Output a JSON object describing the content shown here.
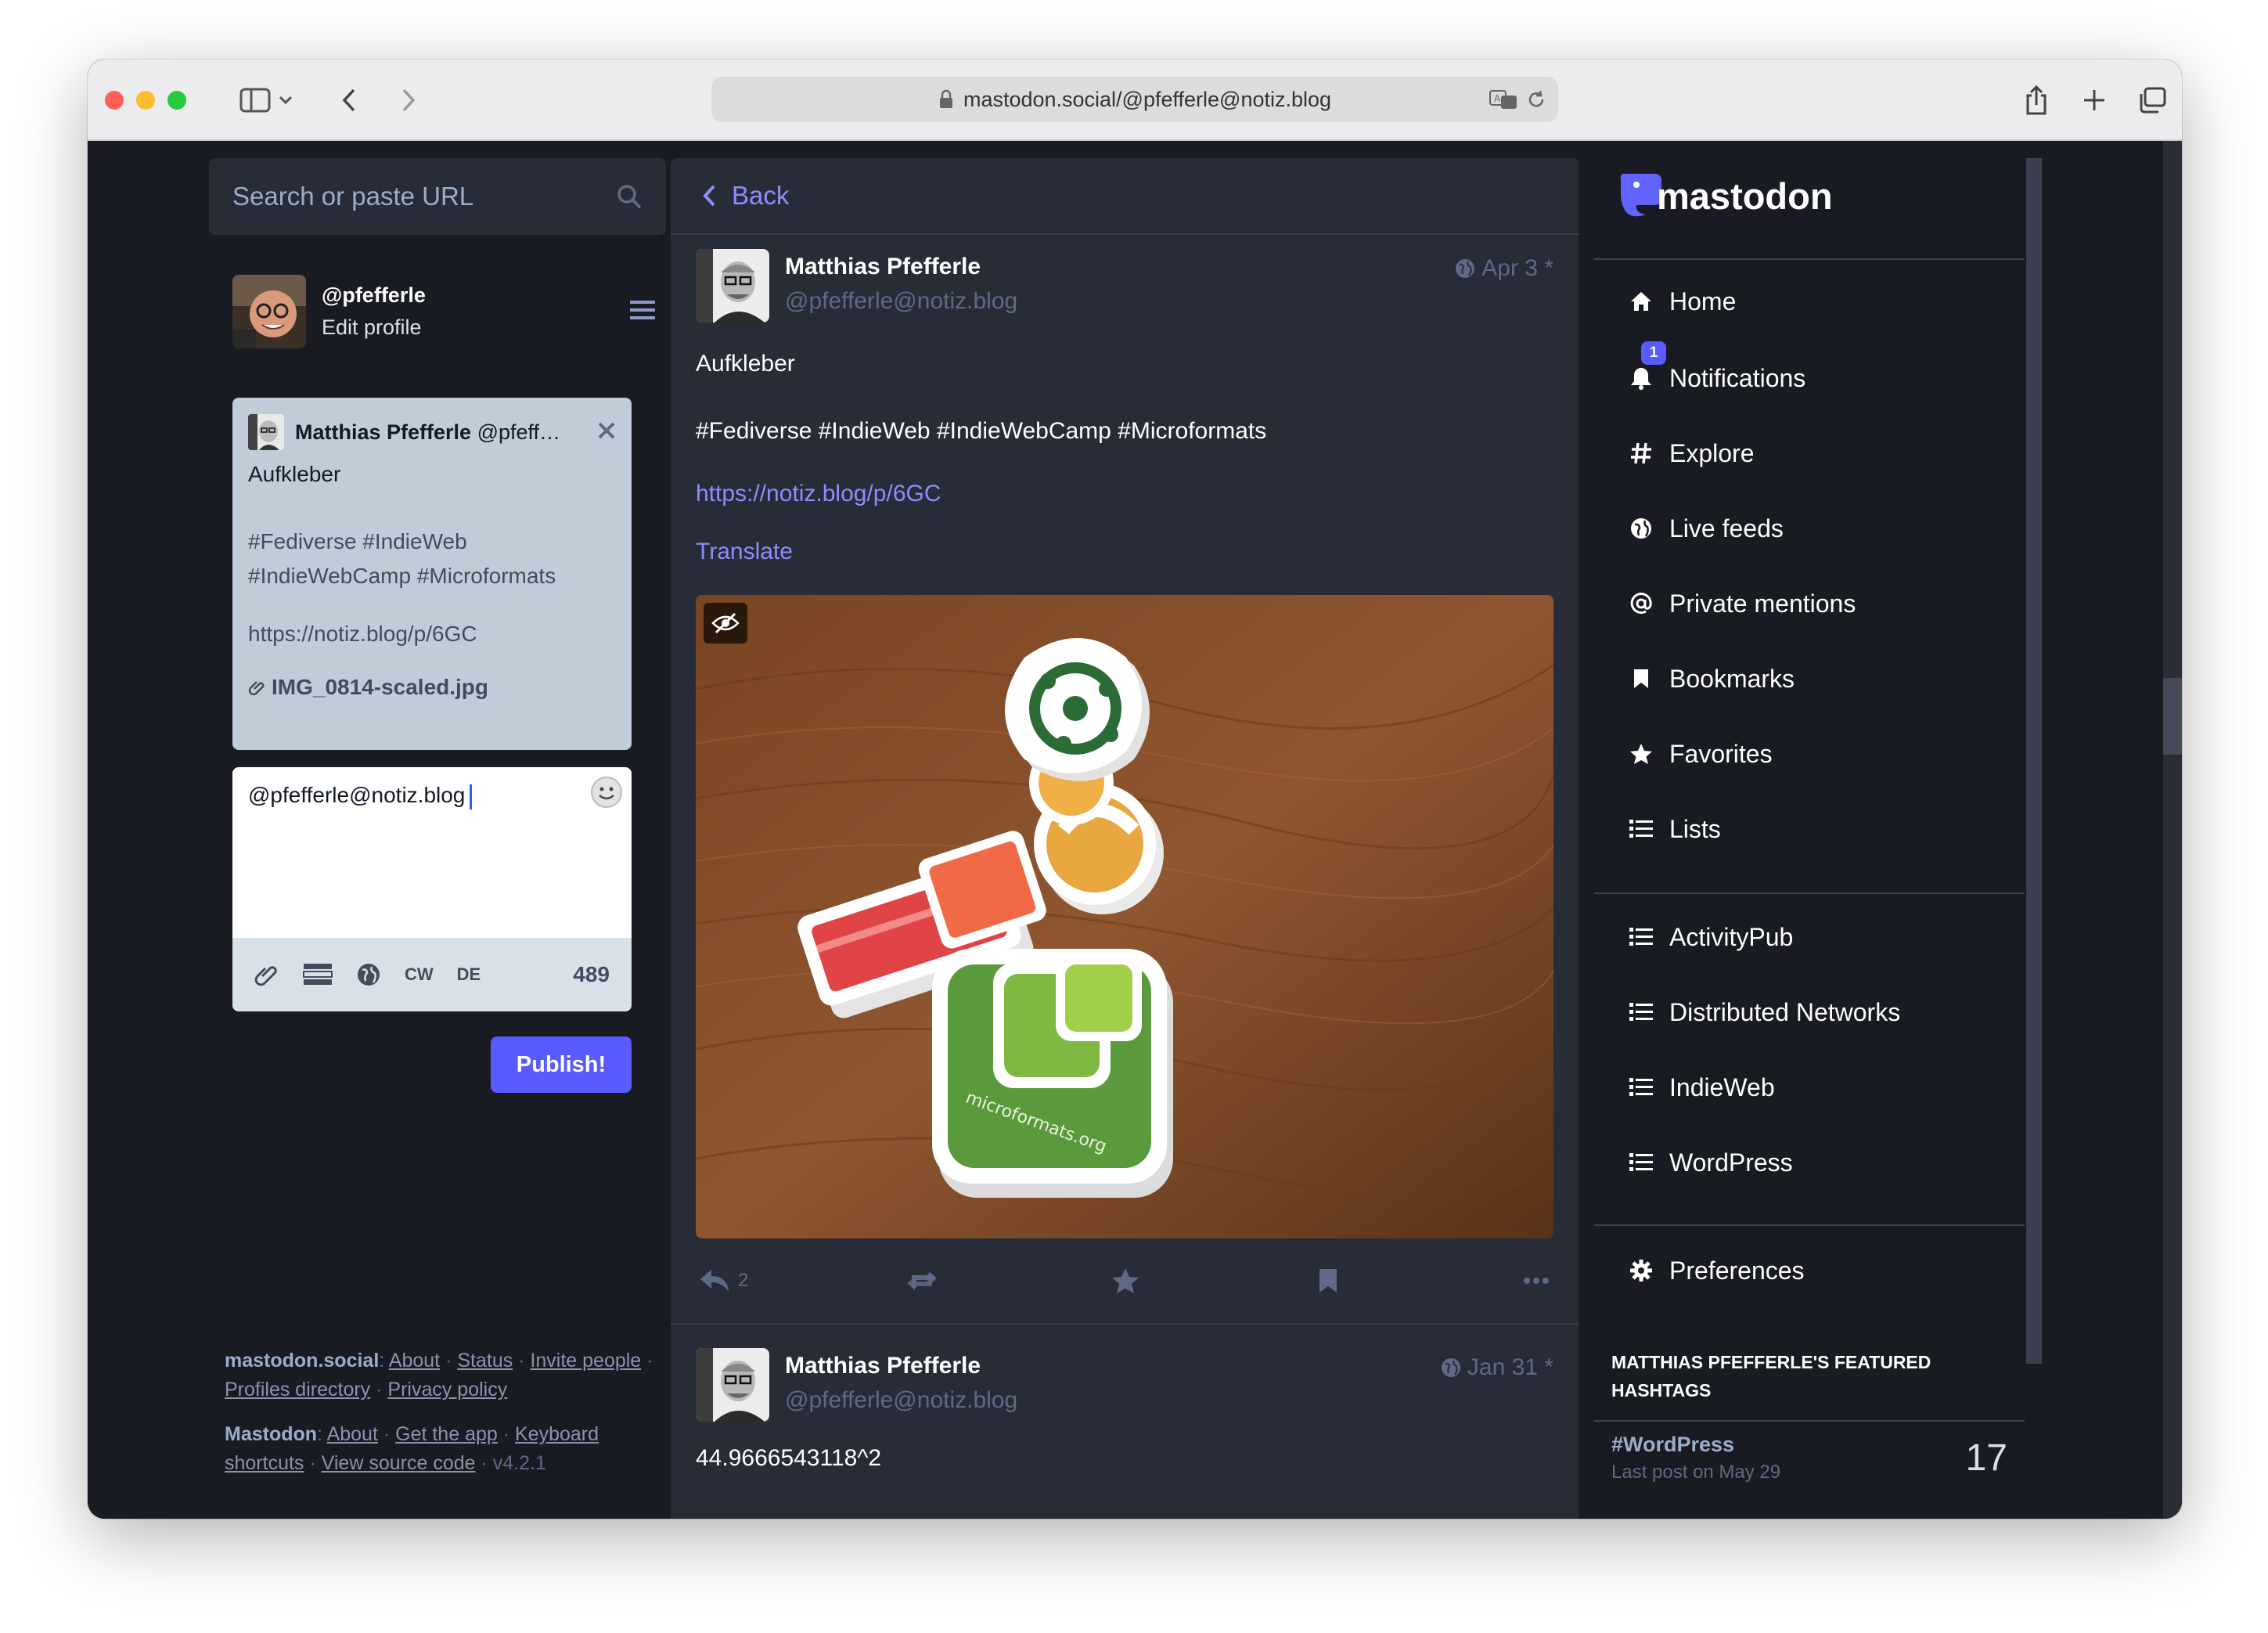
{
  "browser": {
    "url": "mastodon.social/@pfefferle@notiz.blog"
  },
  "left": {
    "search_placeholder": "Search or paste URL",
    "account": {
      "handle": "@pfefferle",
      "edit_label": "Edit profile"
    },
    "reply_card": {
      "name": "Matthias Pfefferle",
      "acct": "@pfeff…",
      "text": "Aufkleber",
      "tags": "#Fediverse #IndieWeb #IndieWebCamp #Microformats",
      "link": "https://notiz.blog/p/6GC",
      "attachment": "IMG_0814-scaled.jpg"
    },
    "compose": {
      "text": "@pfefferle@notiz.blog",
      "cw_label": "CW",
      "lang_label": "DE",
      "char_count": "489",
      "publish_label": "Publish!"
    },
    "footer": {
      "host": "mastodon.social",
      "links1": [
        "About",
        "Status",
        "Invite people",
        "Profiles directory",
        "Privacy policy"
      ],
      "brand": "Mastodon",
      "links2": [
        "About",
        "Get the app",
        "Keyboard shortcuts",
        "View source code"
      ],
      "version": "v4.2.1"
    }
  },
  "center": {
    "back_label": "Back",
    "status": {
      "display_name": "Matthias Pfefferle",
      "acct": "@pfefferle@notiz.blog",
      "time": "Apr 3",
      "edited_mark": "*",
      "text": "Aufkleber",
      "tags": "#Fediverse #IndieWeb #IndieWebCamp #Microformats",
      "link": "https://notiz.blog/p/6GC",
      "translate_label": "Translate",
      "sticker_caption": "microformats.org",
      "reply_count": "2"
    },
    "status2": {
      "display_name": "Matthias Pfefferle",
      "acct": "@pfefferle@notiz.blog",
      "time": "Jan 31",
      "edited_mark": "*",
      "text": "44.9666543118^2"
    }
  },
  "right": {
    "logo_text": "mastodon",
    "nav": [
      {
        "label": "Home",
        "icon": "home-icon"
      },
      {
        "label": "Notifications",
        "icon": "bell-icon",
        "badge": "1"
      },
      {
        "label": "Explore",
        "icon": "hashtag-icon"
      },
      {
        "label": "Live feeds",
        "icon": "globe-icon"
      },
      {
        "label": "Private mentions",
        "icon": "at-icon"
      },
      {
        "label": "Bookmarks",
        "icon": "bookmark-icon"
      },
      {
        "label": "Favorites",
        "icon": "star-icon"
      },
      {
        "label": "Lists",
        "icon": "list-icon"
      }
    ],
    "lists": [
      {
        "label": "ActivityPub",
        "icon": "list-icon"
      },
      {
        "label": "Distributed Networks",
        "icon": "list-icon"
      },
      {
        "label": "IndieWeb",
        "icon": "list-icon"
      },
      {
        "label": "WordPress",
        "icon": "list-icon"
      }
    ],
    "preferences_label": "Preferences",
    "featured": {
      "title": "MATTHIAS PFEFFERLE'S FEATURED HASHTAGS",
      "tag": "#WordPress",
      "sub": "Last post on May 29",
      "count": "17"
    }
  },
  "colors": {
    "accent": "#595aff",
    "link": "#8c8dff",
    "background": "#191b22",
    "panel": "#282c37"
  }
}
